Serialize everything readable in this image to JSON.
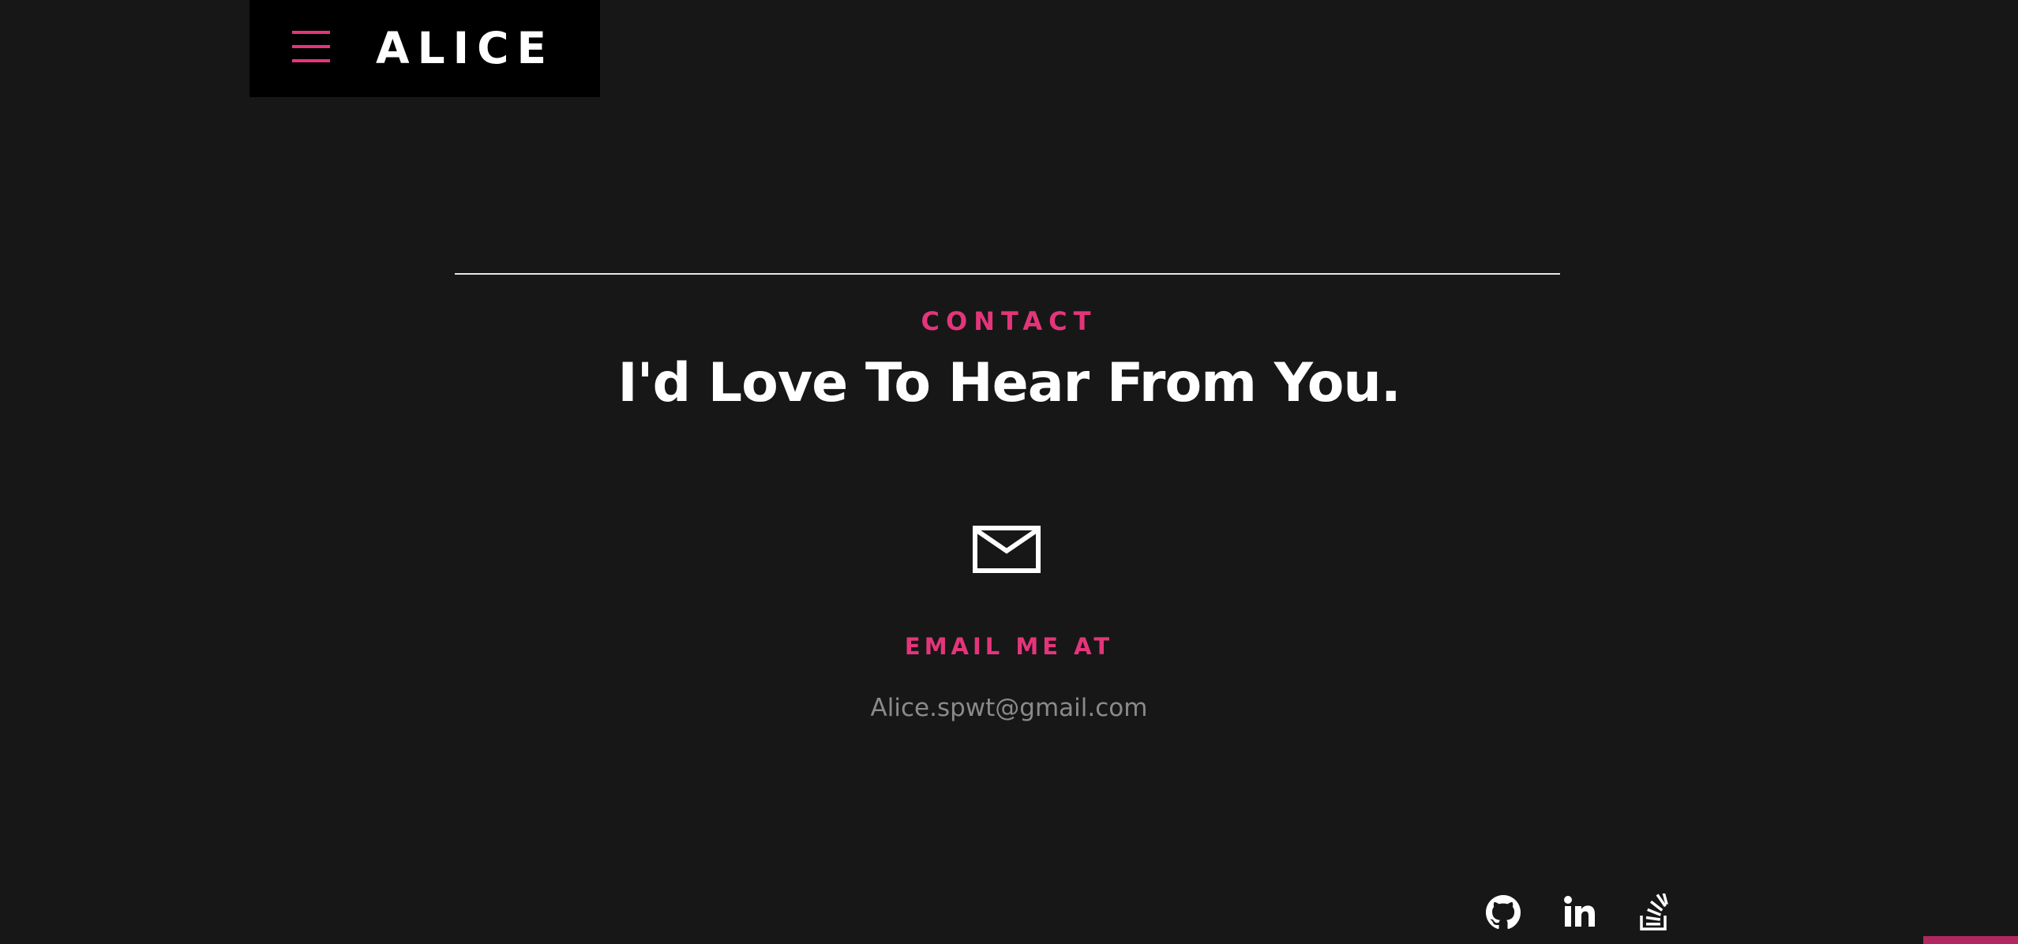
{
  "header": {
    "logo_text": "ALICE",
    "menu_icon": "hamburger-menu-icon"
  },
  "contact": {
    "section_label": "CONTACT",
    "headline": "I'd Love To Hear From You.",
    "mail_icon": "envelope-icon",
    "email_label": "EMAIL ME AT",
    "email_address": "Alice.spwt@gmail.com"
  },
  "social_icons": [
    "github-icon",
    "linkedin-icon",
    "stackoverflow-icon"
  ],
  "colors": {
    "background": "#171717",
    "header_background": "#000000",
    "accent": "#e4357a",
    "text_primary": "#ffffff",
    "text_muted": "#8a8a8a"
  }
}
